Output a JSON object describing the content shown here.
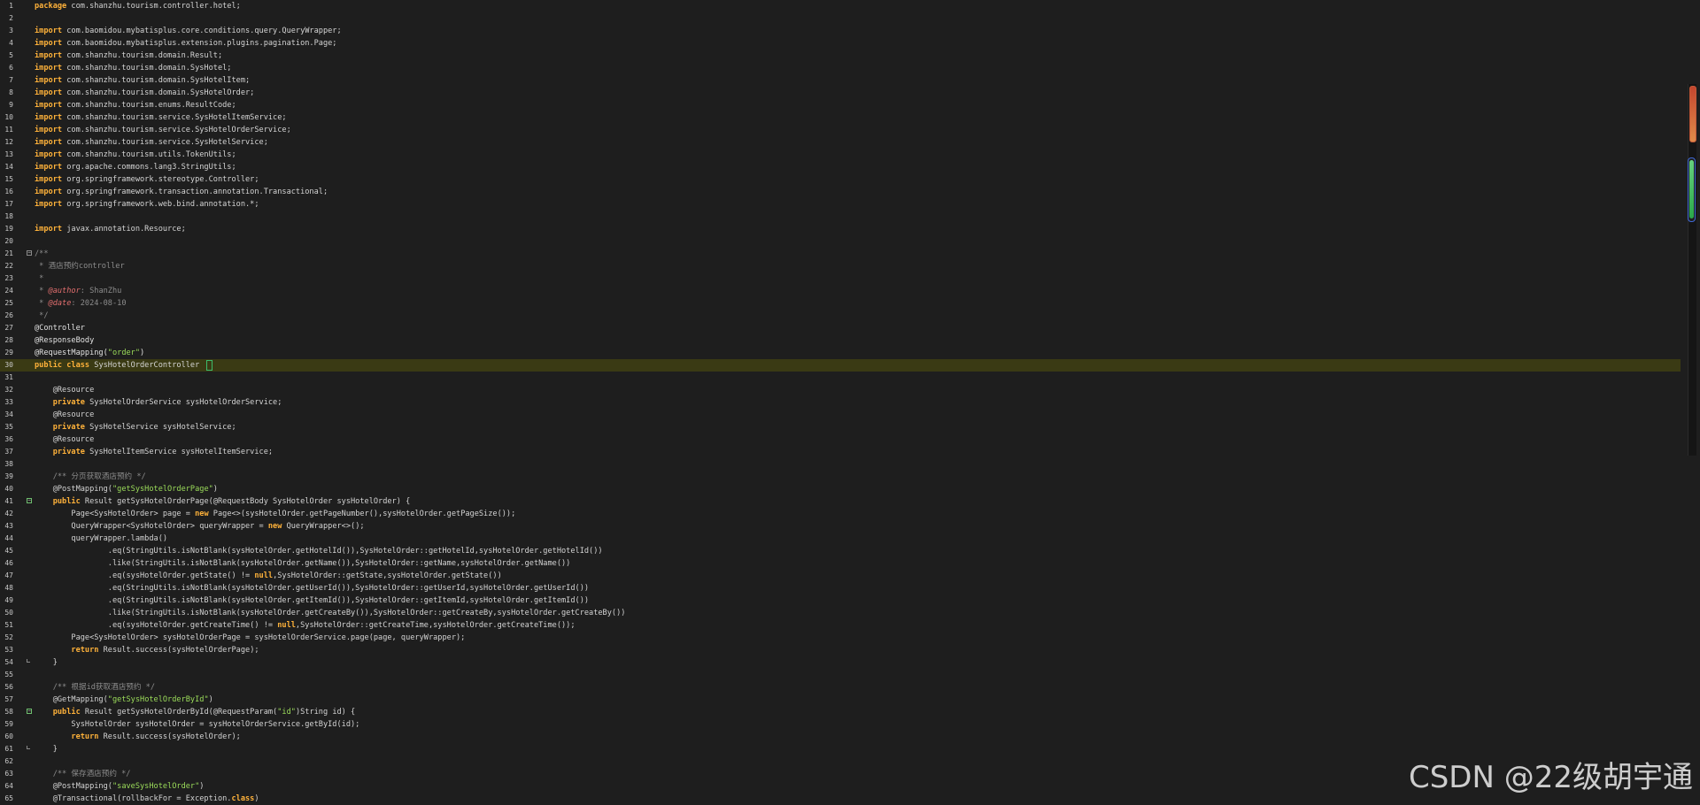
{
  "lines": [
    {
      "n": "1",
      "segs": [
        [
          "kw",
          "package"
        ],
        [
          "t",
          " com.shanzhu.tourism.controller.hotel;"
        ]
      ]
    },
    {
      "n": "2",
      "segs": []
    },
    {
      "n": "3",
      "segs": [
        [
          "kw",
          "import"
        ],
        [
          "t",
          " com.baomidou.mybatisplus.core.conditions.query.QueryWrapper;"
        ]
      ]
    },
    {
      "n": "4",
      "segs": [
        [
          "kw",
          "import"
        ],
        [
          "t",
          " com.baomidou.mybatisplus.extension.plugins.pagination.Page;"
        ]
      ]
    },
    {
      "n": "5",
      "segs": [
        [
          "kw",
          "import"
        ],
        [
          "t",
          " com.shanzhu.tourism.domain.Result;"
        ]
      ]
    },
    {
      "n": "6",
      "segs": [
        [
          "kw",
          "import"
        ],
        [
          "t",
          " com.shanzhu.tourism.domain.SysHotel;"
        ]
      ]
    },
    {
      "n": "7",
      "segs": [
        [
          "kw",
          "import"
        ],
        [
          "t",
          " com.shanzhu.tourism.domain.SysHotelItem;"
        ]
      ]
    },
    {
      "n": "8",
      "segs": [
        [
          "kw",
          "import"
        ],
        [
          "t",
          " com.shanzhu.tourism.domain.SysHotelOrder;"
        ]
      ]
    },
    {
      "n": "9",
      "segs": [
        [
          "kw",
          "import"
        ],
        [
          "t",
          " com.shanzhu.tourism.enums.ResultCode;"
        ]
      ]
    },
    {
      "n": "10",
      "segs": [
        [
          "kw",
          "import"
        ],
        [
          "t",
          " com.shanzhu.tourism.service.SysHotelItemService;"
        ]
      ]
    },
    {
      "n": "11",
      "segs": [
        [
          "kw",
          "import"
        ],
        [
          "t",
          " com.shanzhu.tourism.service.SysHotelOrderService;"
        ]
      ]
    },
    {
      "n": "12",
      "segs": [
        [
          "kw",
          "import"
        ],
        [
          "t",
          " com.shanzhu.tourism.service.SysHotelService;"
        ]
      ]
    },
    {
      "n": "13",
      "segs": [
        [
          "kw",
          "import"
        ],
        [
          "t",
          " com.shanzhu.tourism.utils.TokenUtils;"
        ]
      ]
    },
    {
      "n": "14",
      "segs": [
        [
          "kw",
          "import"
        ],
        [
          "t",
          " org.apache.commons.lang3.StringUtils;"
        ]
      ]
    },
    {
      "n": "15",
      "segs": [
        [
          "kw",
          "import"
        ],
        [
          "t",
          " org.springframework.stereotype.Controller;"
        ]
      ]
    },
    {
      "n": "16",
      "segs": [
        [
          "kw",
          "import"
        ],
        [
          "t",
          " org.springframework.transaction.annotation.Transactional;"
        ]
      ]
    },
    {
      "n": "17",
      "segs": [
        [
          "kw",
          "import"
        ],
        [
          "t",
          " org.springframework.web.bind.annotation.*;"
        ]
      ]
    },
    {
      "n": "18",
      "segs": []
    },
    {
      "n": "19",
      "segs": [
        [
          "kw",
          "import"
        ],
        [
          "t",
          " javax.annotation.Resource;"
        ]
      ]
    },
    {
      "n": "20",
      "segs": []
    },
    {
      "n": "21",
      "fold": "-",
      "segs": [
        [
          "cm",
          "/**"
        ]
      ]
    },
    {
      "n": "22",
      "segs": [
        [
          "cm",
          " * 酒店预约controller"
        ]
      ]
    },
    {
      "n": "23",
      "segs": [
        [
          "cm",
          " *"
        ]
      ]
    },
    {
      "n": "24",
      "segs": [
        [
          "cm",
          " * "
        ],
        [
          "tag",
          "@author"
        ],
        [
          "cm",
          ": ShanZhu"
        ]
      ]
    },
    {
      "n": "25",
      "segs": [
        [
          "cm",
          " * "
        ],
        [
          "tag",
          "@date"
        ],
        [
          "cm",
          ": 2024-08-10"
        ]
      ]
    },
    {
      "n": "26",
      "segs": [
        [
          "cm",
          " */"
        ]
      ]
    },
    {
      "n": "27",
      "segs": [
        [
          "ann",
          "@Controller"
        ]
      ]
    },
    {
      "n": "28",
      "segs": [
        [
          "ann",
          "@ResponseBody"
        ]
      ]
    },
    {
      "n": "29",
      "segs": [
        [
          "ann",
          "@RequestMapping("
        ],
        [
          "str",
          "\"order\""
        ],
        [
          "ann",
          ")"
        ]
      ]
    },
    {
      "n": "30",
      "current": true,
      "segs": [
        [
          "kw",
          "public class"
        ],
        [
          "t",
          " SysHotelOrderController "
        ],
        [
          "caret",
          ""
        ]
      ]
    },
    {
      "n": "31",
      "segs": []
    },
    {
      "n": "32",
      "segs": [
        [
          "t",
          "    @Resource"
        ]
      ]
    },
    {
      "n": "33",
      "segs": [
        [
          "t",
          "    "
        ],
        [
          "kw",
          "private"
        ],
        [
          "t",
          " SysHotelOrderService sysHotelOrderService;"
        ]
      ]
    },
    {
      "n": "34",
      "segs": [
        [
          "t",
          "    @Resource"
        ]
      ]
    },
    {
      "n": "35",
      "segs": [
        [
          "t",
          "    "
        ],
        [
          "kw",
          "private"
        ],
        [
          "t",
          " SysHotelService sysHotelService;"
        ]
      ]
    },
    {
      "n": "36",
      "segs": [
        [
          "t",
          "    @Resource"
        ]
      ]
    },
    {
      "n": "37",
      "segs": [
        [
          "t",
          "    "
        ],
        [
          "kw",
          "private"
        ],
        [
          "t",
          " SysHotelItemService sysHotelItemService;"
        ]
      ]
    },
    {
      "n": "38",
      "segs": []
    },
    {
      "n": "39",
      "segs": [
        [
          "cm",
          "    /** 分页获取酒店预约 */"
        ]
      ]
    },
    {
      "n": "40",
      "segs": [
        [
          "t",
          "    @PostMapping("
        ],
        [
          "str",
          "\"getSysHotelOrderPage\""
        ],
        [
          "t",
          ")"
        ]
      ]
    },
    {
      "n": "41",
      "fold": "-",
      "hl": true,
      "segs": [
        [
          "t",
          "    "
        ],
        [
          "kw",
          "public"
        ],
        [
          "t",
          " Result getSysHotelOrderPage(@RequestBody SysHotelOrder sysHotelOrder) {"
        ]
      ]
    },
    {
      "n": "42",
      "segs": [
        [
          "t",
          "        Page<SysHotelOrder> page = "
        ],
        [
          "kw",
          "new"
        ],
        [
          "t",
          " Page<>(sysHotelOrder.getPageNumber(),sysHotelOrder.getPageSize());"
        ]
      ]
    },
    {
      "n": "43",
      "segs": [
        [
          "t",
          "        QueryWrapper<SysHotelOrder> queryWrapper = "
        ],
        [
          "kw",
          "new"
        ],
        [
          "t",
          " QueryWrapper<>();"
        ]
      ]
    },
    {
      "n": "44",
      "segs": [
        [
          "t",
          "        queryWrapper.lambda()"
        ]
      ]
    },
    {
      "n": "45",
      "segs": [
        [
          "t",
          "                .eq(StringUtils.isNotBlank(sysHotelOrder.getHotelId()),SysHotelOrder::getHotelId,sysHotelOrder.getHotelId())"
        ]
      ]
    },
    {
      "n": "46",
      "segs": [
        [
          "t",
          "                .like(StringUtils.isNotBlank(sysHotelOrder.getName()),SysHotelOrder::getName,sysHotelOrder.getName())"
        ]
      ]
    },
    {
      "n": "47",
      "segs": [
        [
          "t",
          "                .eq(sysHotelOrder.getState() != "
        ],
        [
          "kw",
          "null"
        ],
        [
          "t",
          ",SysHotelOrder::getState,sysHotelOrder.getState())"
        ]
      ]
    },
    {
      "n": "48",
      "segs": [
        [
          "t",
          "                .eq(StringUtils.isNotBlank(sysHotelOrder.getUserId()),SysHotelOrder::getUserId,sysHotelOrder.getUserId())"
        ]
      ]
    },
    {
      "n": "49",
      "segs": [
        [
          "t",
          "                .eq(StringUtils.isNotBlank(sysHotelOrder.getItemId()),SysHotelOrder::getItemId,sysHotelOrder.getItemId())"
        ]
      ]
    },
    {
      "n": "50",
      "segs": [
        [
          "t",
          "                .like(StringUtils.isNotBlank(sysHotelOrder.getCreateBy()),SysHotelOrder::getCreateBy,sysHotelOrder.getCreateBy())"
        ]
      ]
    },
    {
      "n": "51",
      "segs": [
        [
          "t",
          "                .eq(sysHotelOrder.getCreateTime() != "
        ],
        [
          "kw",
          "null"
        ],
        [
          "t",
          ",SysHotelOrder::getCreateTime,sysHotelOrder.getCreateTime());"
        ]
      ]
    },
    {
      "n": "52",
      "segs": [
        [
          "t",
          "        Page<SysHotelOrder> sysHotelOrderPage = sysHotelOrderService.page(page, queryWrapper);"
        ]
      ]
    },
    {
      "n": "53",
      "segs": [
        [
          "t",
          "        "
        ],
        [
          "kw",
          "return"
        ],
        [
          "t",
          " Result.success(sysHotelOrderPage);"
        ]
      ]
    },
    {
      "n": "54",
      "fold": "end",
      "segs": [
        [
          "t",
          "    }"
        ]
      ]
    },
    {
      "n": "55",
      "segs": []
    },
    {
      "n": "56",
      "segs": [
        [
          "cm",
          "    /** 根据id获取酒店预约 */"
        ]
      ]
    },
    {
      "n": "57",
      "segs": [
        [
          "t",
          "    @GetMapping("
        ],
        [
          "str",
          "\"getSysHotelOrderById\""
        ],
        [
          "t",
          ")"
        ]
      ]
    },
    {
      "n": "58",
      "fold": "-",
      "hl": true,
      "segs": [
        [
          "t",
          "    "
        ],
        [
          "kw",
          "public"
        ],
        [
          "t",
          " Result getSysHotelOrderById(@RequestParam("
        ],
        [
          "str",
          "\"id\""
        ],
        [
          "t",
          ")String id) {"
        ]
      ]
    },
    {
      "n": "59",
      "segs": [
        [
          "t",
          "        SysHotelOrder sysHotelOrder = sysHotelOrderService.getById(id);"
        ]
      ]
    },
    {
      "n": "60",
      "segs": [
        [
          "t",
          "        "
        ],
        [
          "kw",
          "return"
        ],
        [
          "t",
          " Result.success(sysHotelOrder);"
        ]
      ]
    },
    {
      "n": "61",
      "fold": "end",
      "segs": [
        [
          "t",
          "    }"
        ]
      ]
    },
    {
      "n": "62",
      "segs": []
    },
    {
      "n": "63",
      "segs": [
        [
          "cm",
          "    /** 保存酒店预约 */"
        ]
      ]
    },
    {
      "n": "64",
      "segs": [
        [
          "t",
          "    @PostMapping("
        ],
        [
          "str",
          "\"saveSysHotelOrder\""
        ],
        [
          "t",
          ")"
        ]
      ]
    },
    {
      "n": "65",
      "segs": [
        [
          "t",
          "    @Transactional(rollbackFor = Exception."
        ],
        [
          "kw",
          "class"
        ],
        [
          "t",
          ")"
        ]
      ]
    }
  ],
  "watermark": "CSDN @22级胡宇通",
  "colors": {
    "background": "#1e1e1e",
    "keyword": "#ffb23a",
    "string": "#9bdc5a",
    "comment": "#8c8c8c",
    "javadoc_tag": "#e36f6f",
    "current_line": "#3a3a14"
  }
}
